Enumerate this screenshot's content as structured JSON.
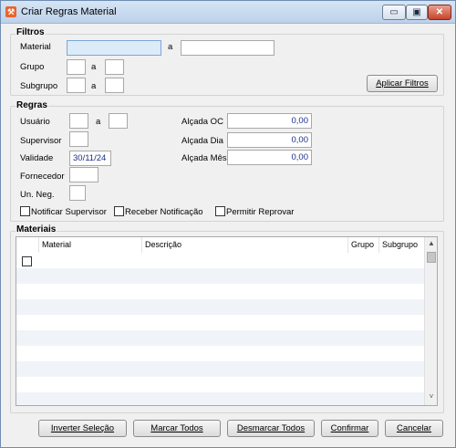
{
  "window": {
    "title": "Criar Regras Material",
    "icon_glyph": "⚒",
    "minimize_glyph": "▭",
    "maximize_glyph": "▣",
    "close_glyph": "✕"
  },
  "filtros": {
    "title": "Filtros",
    "material_label": "Material",
    "material_from": "",
    "material_to": "",
    "grupo_label": "Grupo",
    "grupo_from": "",
    "grupo_to": "",
    "subgrupo_label": "Subgrupo",
    "subgrupo_from": "",
    "subgrupo_to": "",
    "range_sep": "a",
    "apply_button": "Aplicar Filtros"
  },
  "regras": {
    "title": "Regras",
    "usuario_label": "Usuário",
    "usuario_from": "",
    "usuario_to": "",
    "supervisor_label": "Supervisor",
    "supervisor_value": "",
    "validade_label": "Validade",
    "validade_value": "30/11/24",
    "fornecedor_label": "Fornecedor",
    "fornecedor_value": "",
    "unneg_label": "Un. Neg.",
    "unneg_value": "",
    "alcada_oc_label": "Alçada OC",
    "alcada_oc_value": "0,00",
    "alcada_dia_label": "Alçada Dia",
    "alcada_dia_value": "0,00",
    "alcada_mes_label": "Alçada Mês",
    "alcada_mes_value": "0,00",
    "notificar_supervisor": "Notificar Supervisor",
    "receber_notificacao": "Receber Notificação",
    "permitir_reprovar": "Permitir Reprovar",
    "range_sep": "a"
  },
  "materiais": {
    "title": "Materiais",
    "columns": [
      "Material",
      "Descrição",
      "Grupo",
      "Subgrupo"
    ],
    "scroll_up": "▲",
    "scroll_down": "˅"
  },
  "footer": {
    "inverter": "Inverter Seleção",
    "marcar": "Marcar Todos",
    "desmarcar": "Desmarcar Todos",
    "confirmar": "Confirmar",
    "cancelar": "Cancelar"
  }
}
